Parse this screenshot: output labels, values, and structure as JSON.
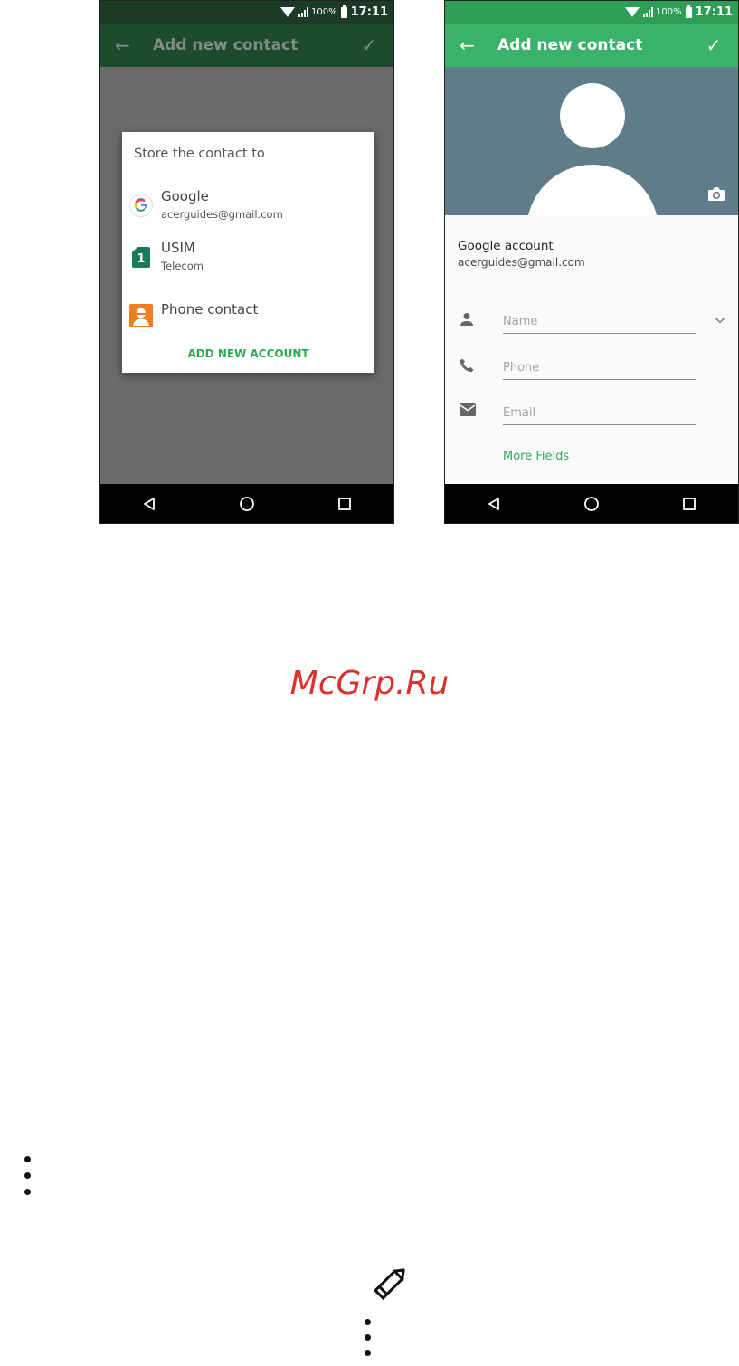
{
  "status_bar": {
    "battery": "100%",
    "time": "17:11"
  },
  "left_screen": {
    "app_bar": {
      "title": "Add new contact"
    },
    "dialog": {
      "title": "Store the contact to",
      "accounts": [
        {
          "name": "Google",
          "detail": "acerguides@gmail.com",
          "icon": "google-icon"
        },
        {
          "name": "USIM",
          "detail": "Telecom",
          "icon": "sim-card-icon"
        },
        {
          "name": "Phone contact",
          "detail": "",
          "icon": "phone-contact-icon"
        }
      ],
      "add_account_label": "ADD NEW ACCOUNT"
    }
  },
  "right_screen": {
    "app_bar": {
      "title": "Add new contact"
    },
    "account": {
      "label": "Google account",
      "email": "acerguides@gmail.com"
    },
    "fields": [
      {
        "placeholder": "Name",
        "icon": "person-icon"
      },
      {
        "placeholder": "Phone",
        "icon": "phone-icon"
      },
      {
        "placeholder": "Email",
        "icon": "email-icon"
      }
    ],
    "more_fields_label": "More Fields"
  },
  "watermark": "McGrp.Ru",
  "colors": {
    "accent_green": "#3bb26a",
    "dark_green": "#1e4a2e",
    "photo_bg": "#5f7d89",
    "watermark_red": "#d9332c"
  }
}
